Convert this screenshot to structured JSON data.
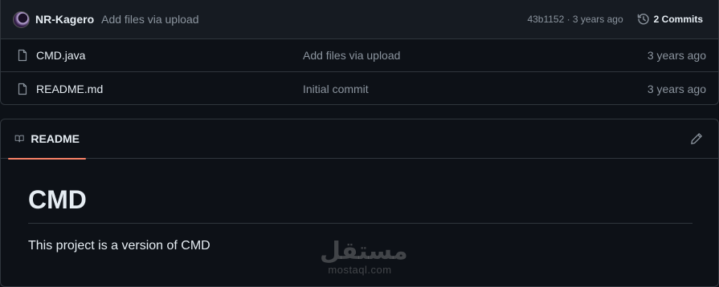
{
  "latest_commit": {
    "author": "NR-Kagero",
    "message": "Add files via upload",
    "meta": "43b1152 · 3 years ago",
    "commits_label": "2 Commits"
  },
  "files": [
    {
      "name": "CMD.java",
      "commit_message": "Add files via upload",
      "age": "3 years ago"
    },
    {
      "name": "README.md",
      "commit_message": "Initial commit",
      "age": "3 years ago"
    }
  ],
  "readme": {
    "tab_label": "README",
    "heading": "CMD",
    "paragraph": "This project is a version of CMD"
  },
  "watermark": {
    "arabic": "مستقل",
    "latin": "mostaql.com"
  },
  "colors": {
    "background": "#0d1117",
    "header_background": "#161b22",
    "border": "#30363d",
    "muted_text": "#8b949e",
    "tab_underline": "#f78166"
  }
}
